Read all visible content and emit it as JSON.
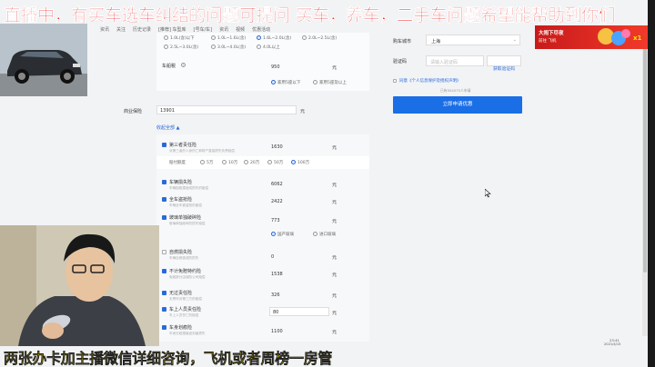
{
  "overlay": {
    "top_banner": "直播中，有买车选车纠结的问题可提问 买车，养车，二手车问题希望能帮助到你们",
    "bottom_banner": "两张办卡加主播微信详细咨询，飞机或者周榜一房管"
  },
  "nav": {
    "items": [
      "资讯",
      "关注",
      "历史记录",
      "[推荐] 车型库",
      "[号车/车]",
      "资讯",
      "视频",
      "优惠活动"
    ]
  },
  "displacement_options": {
    "row1": [
      "1.0L(含)以下",
      "1.0L~1.6L(含)",
      "1.6L~2.0L(含)",
      "2.0L~2.5L(含)"
    ],
    "row2": [
      "2.5L~3.0L(含)",
      "3.0L~4.0L(含)",
      "4.0L以上"
    ],
    "selected": "1.6L~2.0L(含)"
  },
  "vehicle_tax": {
    "label": "车船税",
    "value": "950",
    "unit": "元",
    "options": [
      "家用5座以下",
      "家用5座及以上"
    ],
    "selected": "家用5座以下"
  },
  "commercial": {
    "label": "商业保险",
    "value": "13901",
    "unit": "元",
    "collapse_link": "收起全部 ▲"
  },
  "insurance": [
    {
      "name": "第三者责任险",
      "hint": "对第三者的人身伤亡和财产直接损失负责赔偿",
      "value": "1630",
      "unit": "元",
      "checked": true
    },
    {
      "name": "车辆损失险",
      "hint": "车辆因碰撞造成损失的赔偿",
      "value": "6062",
      "unit": "元",
      "checked": true
    },
    {
      "name": "全车盗抢险",
      "hint": "车辆全车被盗抢的赔偿",
      "value": "2422",
      "unit": "元",
      "checked": true
    },
    {
      "name": "玻璃单独破碎险",
      "hint": "玻璃单独破碎的损失赔偿",
      "value": "773",
      "unit": "元",
      "checked": true
    },
    {
      "name": "自燃损失险",
      "hint": "车辆自燃造成的损失",
      "value": "0",
      "unit": "元",
      "checked": false
    },
    {
      "name": "不计免赔特约险",
      "hint": "免赔部分由保险公司赔偿",
      "value": "1538",
      "unit": "元",
      "checked": true
    },
    {
      "name": "无过责任险",
      "hint": "无责时对第三方的赔偿",
      "value": "326",
      "unit": "元",
      "checked": true
    },
    {
      "name": "车上人员责任险",
      "hint": "车上人员伤亡的赔偿",
      "value": "80",
      "unit": "元",
      "checked": true
    },
    {
      "name": "车身划痕险",
      "hint": "车身无碰撞痕迹划痕损失",
      "value": "1100",
      "unit": "元",
      "checked": true
    }
  ],
  "liability_limits": {
    "label": "赔付额度",
    "options": [
      "5万",
      "10万",
      "20万",
      "50万",
      "100万"
    ],
    "selected": "100万"
  },
  "glass_options": {
    "options": [
      "国产玻璃",
      "进口玻璃"
    ],
    "selected": "国产玻璃"
  },
  "form": {
    "city_label": "购车城市",
    "city_value": "上海",
    "code_label": "验证码",
    "code_placeholder": "请输入验证码",
    "get_code": "获取验证码",
    "agree_text": "同意《个人信息保护及授权声明》",
    "applied": "已有504075人申请",
    "submit": "立即申请优惠"
  },
  "game": {
    "title": "大闹下尽夜",
    "sub": "前往  飞机",
    "badge": "x1"
  },
  "clock": {
    "time": "23:41",
    "date": "2021/4/15"
  },
  "colors": {
    "accent": "#1a6ee6",
    "banner_red": "#e82020",
    "banner_yellow": "#ffe600"
  }
}
